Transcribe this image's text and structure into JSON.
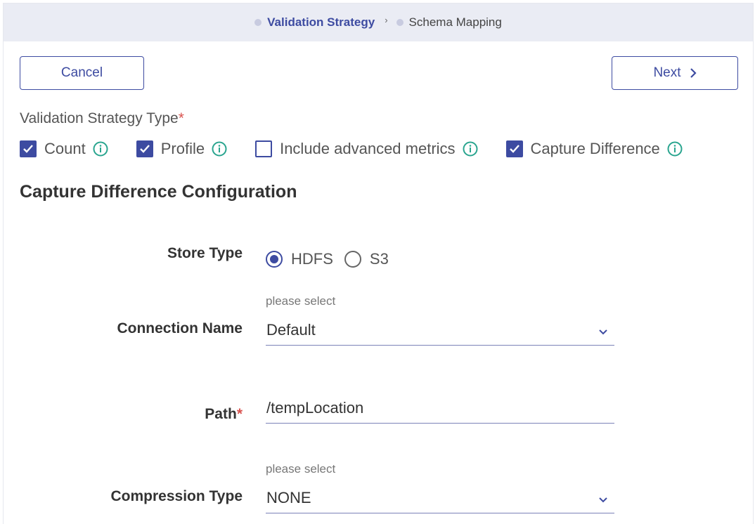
{
  "stepper": {
    "steps": [
      {
        "label": "Validation Strategy",
        "active": true
      },
      {
        "label": "Schema Mapping",
        "active": false
      }
    ],
    "arrow": "›"
  },
  "toolbar": {
    "cancel_label": "Cancel",
    "next_label": "Next"
  },
  "validation_strategy": {
    "label": "Validation Strategy Type",
    "required_mark": "*",
    "options": [
      {
        "label": "Count",
        "checked": true
      },
      {
        "label": "Profile",
        "checked": true
      },
      {
        "label": "Include advanced metrics",
        "checked": false
      },
      {
        "label": "Capture Difference",
        "checked": true
      }
    ]
  },
  "config": {
    "title": "Capture Difference Configuration",
    "store_type": {
      "label": "Store Type",
      "options": [
        {
          "label": "HDFS",
          "checked": true
        },
        {
          "label": "S3",
          "checked": false
        }
      ]
    },
    "connection_name": {
      "label": "Connection Name",
      "hint": "please select",
      "value": "Default"
    },
    "path": {
      "label": "Path",
      "required_mark": "*",
      "value": "/tempLocation"
    },
    "compression_type": {
      "label": "Compression Type",
      "hint": "please select",
      "value": "NONE"
    }
  },
  "colors": {
    "accent": "#3d4ba1",
    "info_icon": "#2aa58f",
    "required": "#d9534f",
    "stepper_bg": "#eaecf4"
  }
}
